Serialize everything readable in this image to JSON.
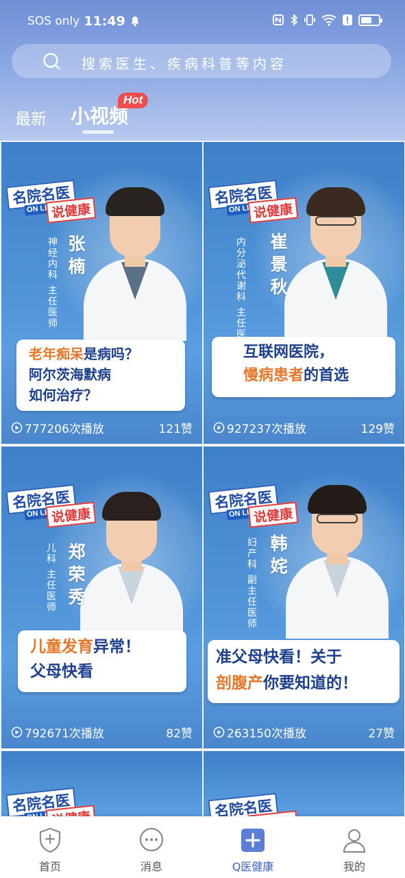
{
  "status_bar": {
    "carrier": "SOS only",
    "time": "11:49"
  },
  "search": {
    "placeholder": "搜索医生、疾病科普等内容"
  },
  "tabs": [
    {
      "label": "最新",
      "active": false
    },
    {
      "label": "小视频",
      "active": true,
      "badge": "Hot"
    }
  ],
  "logo_text": {
    "line1": "名院名医",
    "line2": "ON LINE",
    "line3": "说健康"
  },
  "cards": [
    {
      "name": "张楠",
      "title": "神经内科 主任医师",
      "headline": [
        [
          {
            "t": "老年痴呆",
            "o": true
          },
          {
            "t": "是病吗？",
            "o": false
          }
        ],
        [
          {
            "t": "阿尔茨海默病",
            "o": false
          }
        ],
        [
          {
            "t": "如何治疗？",
            "o": false
          }
        ]
      ],
      "plays": "777206次播放",
      "likes": "121赞"
    },
    {
      "name": "崔景秋",
      "title": "内分泌代谢科 主任医师",
      "headline": [
        [
          {
            "t": "互联网医院，",
            "o": false
          }
        ],
        [
          {
            "t": "慢病患者",
            "o": true
          },
          {
            "t": "的首选",
            "o": false
          }
        ]
      ],
      "plays": "927237次播放",
      "likes": "129赞"
    },
    {
      "name": "郑荣秀",
      "title": "儿科 主任医师",
      "headline": [
        [
          {
            "t": "儿童发育",
            "o": true
          },
          {
            "t": "异常！",
            "o": false
          }
        ],
        [
          {
            "t": "父母快看",
            "o": false
          }
        ]
      ],
      "plays": "792671次播放",
      "likes": "82赞"
    },
    {
      "name": "韩姹",
      "title": "妇产科 副主任医师",
      "headline": [
        [
          {
            "t": "准父母快看！关于",
            "o": false
          }
        ],
        [
          {
            "t": "剖腹产",
            "o": true
          },
          {
            "t": "你要知道的！",
            "o": false
          }
        ]
      ],
      "plays": "263150次播放",
      "likes": "27赞"
    }
  ],
  "bottom_nav": [
    {
      "label": "首页",
      "icon": "home-shield-icon",
      "active": false
    },
    {
      "label": "消息",
      "icon": "message-bubble-icon",
      "active": false
    },
    {
      "label": "Q医健康",
      "icon": "q-health-icon",
      "active": true
    },
    {
      "label": "我的",
      "icon": "profile-icon",
      "active": false
    }
  ],
  "colors": {
    "accent": "#3d64c8",
    "headline_blue": "#1d3f8f",
    "headline_orange": "#e5782b",
    "hot_badge": "#f04e4e"
  }
}
